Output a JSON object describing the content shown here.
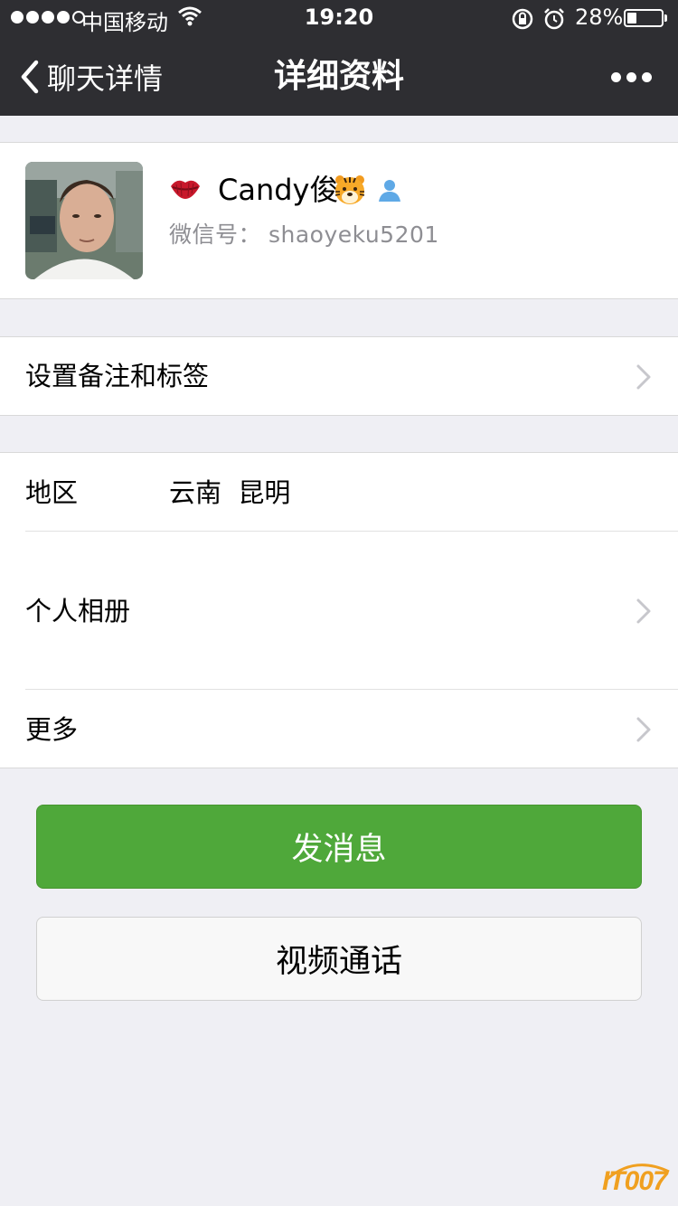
{
  "status_bar": {
    "carrier": "中国移动",
    "time": "19:20",
    "battery_text": "28%",
    "battery_level": 0.28
  },
  "nav": {
    "back_label": "聊天详情",
    "title": "详细资料",
    "more_icon": "ellipsis-icon"
  },
  "profile": {
    "nickname": "Candy俊",
    "wechat_id_label": "微信号：",
    "wechat_id": "shaoyeku5201",
    "icons": [
      "lips-icon",
      "tiger-face-icon",
      "person-icon"
    ]
  },
  "remark": {
    "label": "设置备注和标签"
  },
  "info": {
    "region_label": "地区",
    "region_value": "云南  昆明",
    "album_label": "个人相册",
    "more_label": "更多"
  },
  "buttons": {
    "send_message": "发消息",
    "video_call": "视频通话"
  },
  "watermark": {
    "text": "IT007"
  },
  "colors": {
    "nav_bg": "#2e2e32",
    "page_bg": "#efeff4",
    "send_green": "#4fa83a",
    "secondary_text": "#8e8e93",
    "watermark": "#f0a020"
  }
}
